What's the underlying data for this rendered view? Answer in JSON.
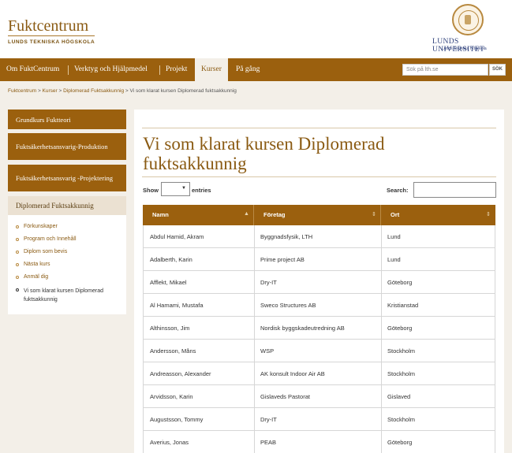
{
  "header": {
    "site_title": "Fuktcentrum",
    "site_subtitle": "LUNDS TEKNISKA HÖGSKOLA",
    "university_name": "LUNDS UNIVERSITET",
    "university_sub": "Lunds Tekniska Högskola",
    "brand_color": "#9b600e"
  },
  "nav": {
    "items": [
      {
        "label": "Om FuktCentrum"
      },
      {
        "label": "Verktyg och Hjälpmedel"
      },
      {
        "label": "Projekt"
      },
      {
        "label": "Kurser",
        "active": true
      },
      {
        "label": "På gång"
      }
    ],
    "search_placeholder": "Sök på lth.se",
    "search_button": "SÖK"
  },
  "breadcrumb": [
    "Fuktcentrum",
    "Kurser",
    "Diplomerad Fuktsakkunnig",
    "Vi som klarat kursen Diplomerad fuktsakkunnig"
  ],
  "sidebar": {
    "buttons": [
      {
        "label": "Grundkurs Fuktteori"
      },
      {
        "label": "Fuktsäkerhetsansvarig-Produktion"
      },
      {
        "label": "Fuktsäkerhetsansvarig -Projektering"
      }
    ],
    "active_section": "Diplomerad Fuktsakkunnig",
    "subitems": [
      {
        "label": "Förkunskaper"
      },
      {
        "label": "Program och Innehåll"
      },
      {
        "label": "Diplom som bevis"
      },
      {
        "label": "Nästa kurs"
      },
      {
        "label": "Anmäl dig"
      },
      {
        "label": "Vi som klarat kursen Diplomerad fuktsakkunnig",
        "current": true
      }
    ]
  },
  "main": {
    "title": "Vi som klarat kursen Diplomerad fuktsakkunnig",
    "show_label": "Show",
    "entries_label": "entries",
    "search_label": "Search:",
    "columns": [
      "Namn",
      "Företag",
      "Ort"
    ],
    "rows": [
      [
        "Abdul Hamid, Akram",
        "Byggnadsfysik, LTH",
        "Lund"
      ],
      [
        "Adalberth, Karin",
        "Prime project AB",
        "Lund"
      ],
      [
        "Afflekt, Mikael",
        "Dry-IT",
        "Göteborg"
      ],
      [
        "Al Hamami, Mustafa",
        "Sweco Structures AB",
        "Kristianstad"
      ],
      [
        "Althinsson, Jim",
        "Nordisk byggskadeutredning AB",
        "Göteborg"
      ],
      [
        "Andersson, Måns",
        "WSP",
        "Stockholm"
      ],
      [
        "Andreasson, Alexander",
        "AK konsult Indoor Air AB",
        "Stockholm"
      ],
      [
        "Arvidsson, Karin",
        "Gislaveds Pastorat",
        "Gislaved"
      ],
      [
        "Augustsson, Tommy",
        "Dry-IT",
        "Stockholm"
      ],
      [
        "Averius, Jonas",
        "PEAB",
        "Göteborg"
      ]
    ]
  }
}
